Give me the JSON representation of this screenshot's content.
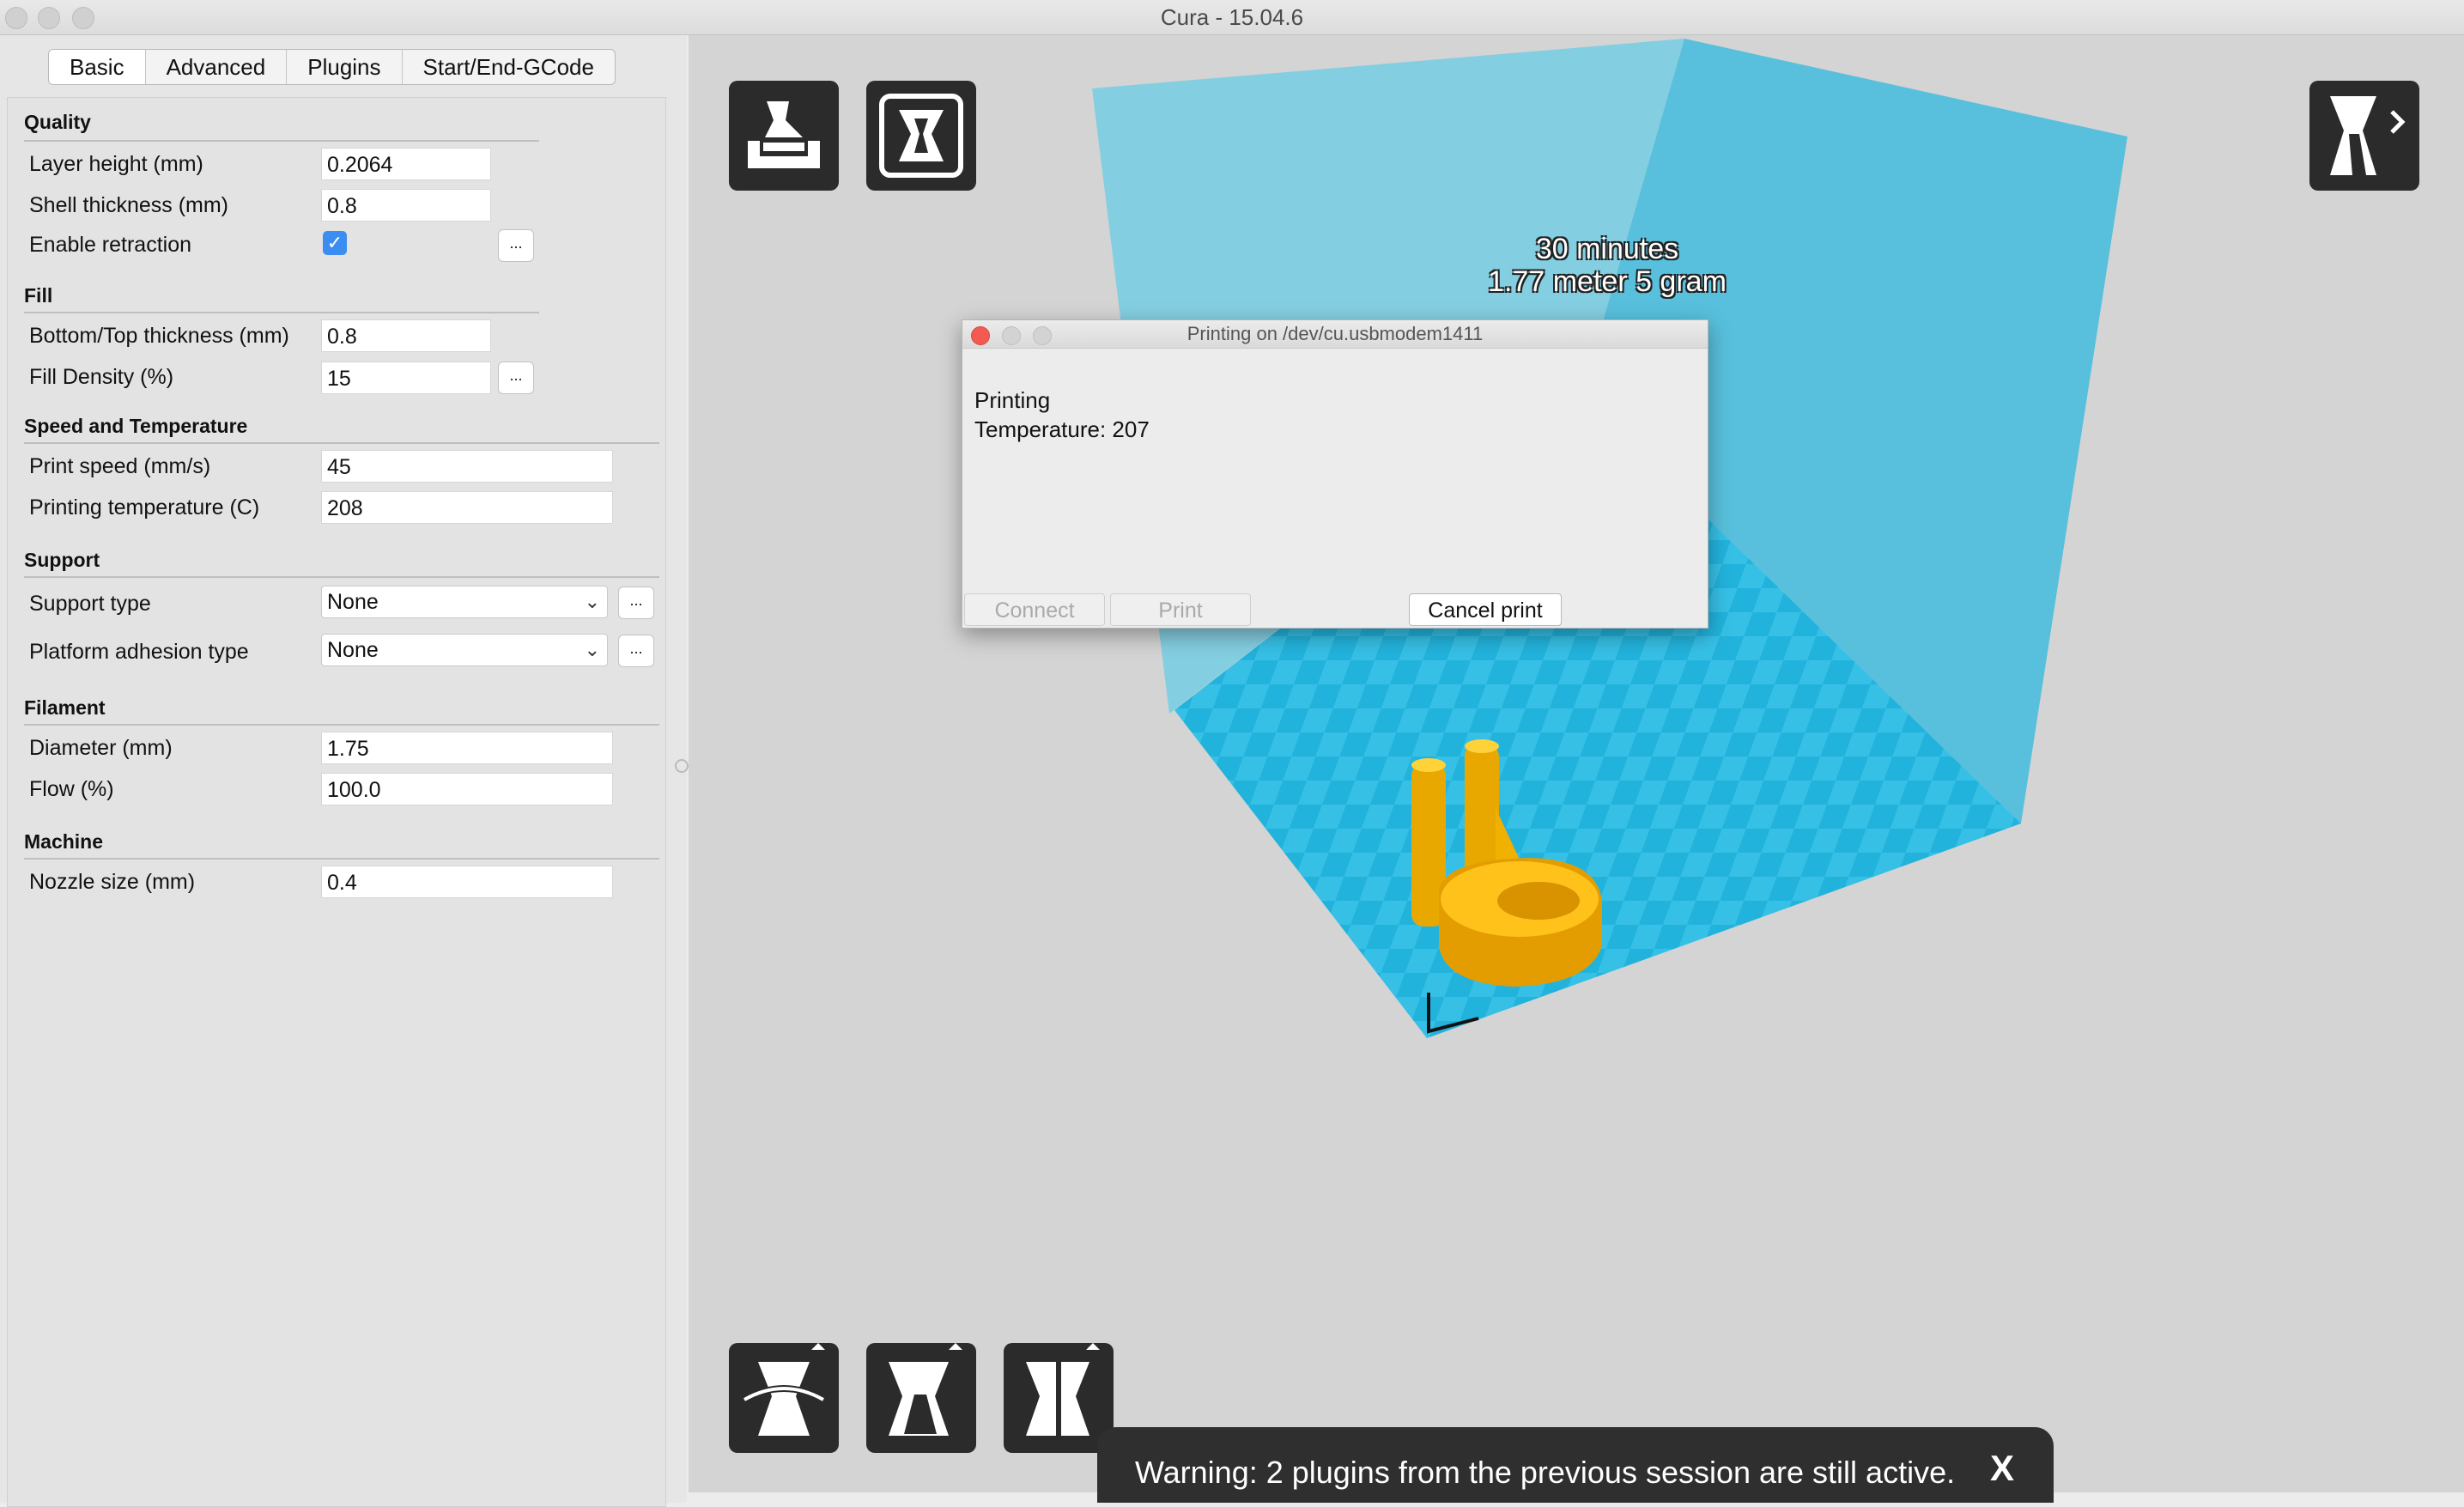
{
  "window": {
    "title": "Cura - 15.04.6"
  },
  "tabs": [
    {
      "label": "Basic",
      "active": true
    },
    {
      "label": "Advanced",
      "active": false
    },
    {
      "label": "Plugins",
      "active": false
    },
    {
      "label": "Start/End-GCode",
      "active": false
    }
  ],
  "settings": {
    "quality": {
      "title": "Quality",
      "layer_height": {
        "label": "Layer height (mm)",
        "value": "0.2064"
      },
      "shell_thickness": {
        "label": "Shell thickness (mm)",
        "value": "0.8"
      },
      "enable_retraction": {
        "label": "Enable retraction",
        "checked": true,
        "check_glyph": "✓"
      }
    },
    "fill": {
      "title": "Fill",
      "bottom_top_thickness": {
        "label": "Bottom/Top thickness (mm)",
        "value": "0.8"
      },
      "fill_density": {
        "label": "Fill Density (%)",
        "value": "15"
      }
    },
    "speed_temp": {
      "title": "Speed and Temperature",
      "print_speed": {
        "label": "Print speed (mm/s)",
        "value": "45"
      },
      "printing_temperature": {
        "label": "Printing temperature (C)",
        "value": "208"
      }
    },
    "support": {
      "title": "Support",
      "support_type": {
        "label": "Support type",
        "value": "None"
      },
      "platform_adhesion": {
        "label": "Platform adhesion type",
        "value": "None"
      }
    },
    "filament": {
      "title": "Filament",
      "diameter": {
        "label": "Diameter (mm)",
        "value": "1.75"
      },
      "flow": {
        "label": "Flow (%)",
        "value": "100.0"
      }
    },
    "machine": {
      "title": "Machine",
      "nozzle_size": {
        "label": "Nozzle size (mm)",
        "value": "0.4"
      }
    },
    "dots_label": "...",
    "chevron": "⌄"
  },
  "viewport": {
    "print_time": "30 minutes",
    "print_material": "1.77 meter 5 gram"
  },
  "dialog": {
    "title": "Printing on /dev/cu.usbmodem1411",
    "status": "Printing",
    "temperature": "Temperature: 207",
    "connect_label": "Connect",
    "print_label": "Print",
    "cancel_label": "Cancel print"
  },
  "warning": {
    "text": "Warning: 2 plugins from the previous session are still active.",
    "close_label": "X"
  },
  "colors": {
    "build_volume": "#5bc4de",
    "build_plate": "#2bb7e0",
    "model": "#f6b400",
    "toolbar": "#2b2b2b"
  }
}
